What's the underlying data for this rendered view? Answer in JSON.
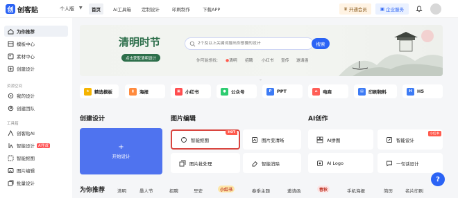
{
  "header": {
    "logo_text": "创客贴",
    "logo_mark": "创",
    "edition": "个人版",
    "nav": [
      "首页",
      "AI工具箱",
      "定制设计",
      "印刷制作",
      "下载APP"
    ],
    "vip_button": "开通会员",
    "enterprise_button": "企业服务"
  },
  "sidebar": {
    "items_top": [
      {
        "label": "为你推荐",
        "icon": "home-icon"
      },
      {
        "label": "模板中心",
        "icon": "template-icon"
      },
      {
        "label": "素材中心",
        "icon": "material-icon"
      },
      {
        "label": "创建设计",
        "icon": "plus-square-icon"
      }
    ],
    "section_resources": "资源空间",
    "items_resources": [
      {
        "label": "我的设计",
        "icon": "design-icon"
      },
      {
        "label": "创建团队",
        "icon": "team-icon"
      }
    ],
    "section_tools": "工具箱",
    "items_tools": [
      {
        "label": "创客贴AI",
        "icon": "ai-icon"
      },
      {
        "label": "智能设计",
        "icon": "smart-design-icon",
        "badge": "AI生成"
      },
      {
        "label": "智能抠图",
        "icon": "cutout-icon"
      },
      {
        "label": "图片编辑",
        "icon": "image-edit-icon"
      },
      {
        "label": "批量设计",
        "icon": "batch-icon"
      }
    ]
  },
  "banner": {
    "title": "清明时节",
    "subtitle": "点击获取清明设计",
    "search_placeholder": "2个及以上关键词搜出你想要的设计",
    "search_button": "搜索",
    "hot_label": "你可能想找:",
    "hot_terms": [
      "清明",
      "招聘",
      "小红书",
      "宣传",
      "邀请函"
    ]
  },
  "categories": [
    {
      "label": "精选模板",
      "color": "#f5b400"
    },
    {
      "label": "海报",
      "color": "#ff8a3d"
    },
    {
      "label": "小红书",
      "color": "#ff4d4f"
    },
    {
      "label": "公众号",
      "color": "#2ecc71"
    },
    {
      "label": "PPT",
      "color": "#3d7bf5"
    },
    {
      "label": "电商",
      "color": "#ff5e57"
    },
    {
      "label": "印刷物料",
      "color": "#3d7bf5"
    },
    {
      "label": "H5",
      "color": "#3d7bf5"
    }
  ],
  "sections": {
    "create": {
      "title": "创建设计",
      "card_label": "开始设计",
      "card_plus": "+"
    },
    "image_edit": {
      "title": "图片编辑",
      "tools": [
        {
          "label": "智能抠图",
          "tag": "HOT"
        },
        {
          "label": "图片变清晰"
        },
        {
          "label": "图片批处理"
        },
        {
          "label": "智能消除"
        }
      ]
    },
    "ai_create": {
      "title": "AI创作",
      "tools": [
        {
          "label": "AI拼图"
        },
        {
          "label": "智能设计",
          "tag": "小红书"
        },
        {
          "label": "AI Logo"
        },
        {
          "label": "一句话设计"
        }
      ]
    }
  },
  "bottom_tabs": {
    "active": "为你推荐",
    "tabs": [
      "清明",
      "愚人节",
      "招聘",
      "早安",
      "小红书",
      "春季主题",
      "邀请函",
      "春秋",
      "手机海报",
      "简历",
      "名片印刷"
    ]
  },
  "help_button": "?",
  "colors": {
    "brand": "#2b63f5",
    "highlight": "#d9453f",
    "hot": "#ff5a4d"
  }
}
